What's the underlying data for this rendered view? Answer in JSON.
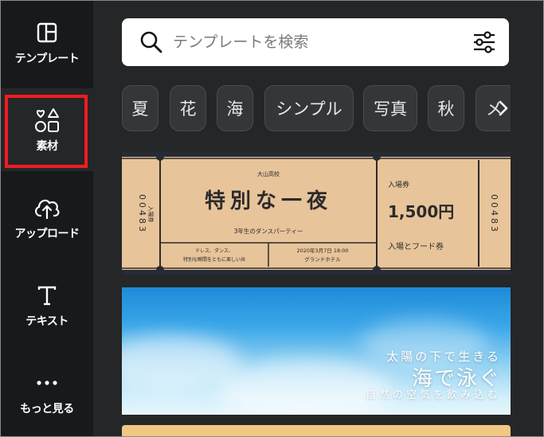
{
  "sidebar": {
    "items": [
      {
        "label": "テンプレート",
        "icon": "layout-icon"
      },
      {
        "label": "素材",
        "icon": "elements-icon"
      },
      {
        "label": "アップロード",
        "icon": "cloud-upload-icon"
      },
      {
        "label": "テキスト",
        "icon": "text-icon"
      },
      {
        "label": "もっと見る",
        "icon": "more-icon"
      }
    ]
  },
  "search": {
    "placeholder": "テンプレートを検索"
  },
  "chips": [
    "夏",
    "花",
    "海",
    "シンプル",
    "写真",
    "秋",
    "メ"
  ],
  "templates": {
    "ticket": {
      "school": "大山高校",
      "title": "特別な一夜",
      "subtitle": "3年生のダンスパーティー",
      "dress": "ドレス、ダンス、",
      "dress2": "特別な瞬間をともに楽しい共",
      "date": "2020年3月7日 18:00",
      "venue": "グランドホテル",
      "admission_label": "入場券",
      "price": "1,500円",
      "food": "入場とフード券",
      "serial": "00483",
      "serial_label": "入場券"
    },
    "sea": {
      "line1": "太陽の下で生きる",
      "line2": "海で泳ぐ",
      "line3": "自然の空気を飲み込む"
    }
  },
  "colors": {
    "rail_bg": "#18191b",
    "panel_bg": "#252627",
    "highlight": "#ee1c24",
    "ticket_bg": "#e8c49a"
  }
}
